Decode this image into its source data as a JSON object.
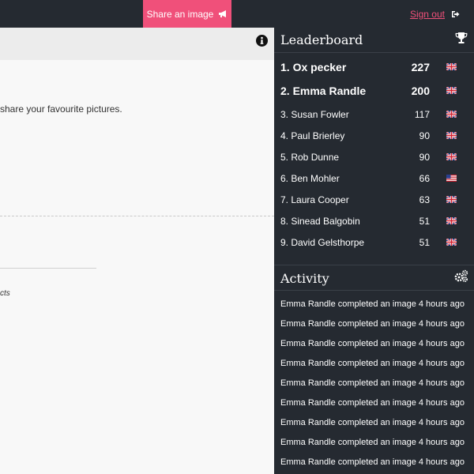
{
  "topbar": {
    "share_label": "Share an image",
    "signout_label": "Sign out"
  },
  "main": {
    "intro_text": "share your favourite pictures.",
    "italic_text": "cts"
  },
  "leaderboard": {
    "title": "Leaderboard",
    "entries": [
      {
        "label": "1. Ox pecker",
        "score": "227",
        "flag": "uk"
      },
      {
        "label": "2. Emma Randle",
        "score": "200",
        "flag": "uk"
      },
      {
        "label": "3. Susan Fowler",
        "score": "117",
        "flag": "uk"
      },
      {
        "label": "4. Paul Brierley",
        "score": "90",
        "flag": "uk"
      },
      {
        "label": "5. Rob Dunne",
        "score": "90",
        "flag": "uk"
      },
      {
        "label": "6. Ben Mohler",
        "score": "66",
        "flag": "us"
      },
      {
        "label": "7. Laura Cooper",
        "score": "63",
        "flag": "uk"
      },
      {
        "label": "8. Sinead Balgobin",
        "score": "51",
        "flag": "uk"
      },
      {
        "label": "9. David Gelsthorpe",
        "score": "51",
        "flag": "uk"
      }
    ]
  },
  "activity": {
    "title": "Activity",
    "items": [
      "Emma Randle completed an image 4 hours ago",
      "Emma Randle completed an image 4 hours ago",
      "Emma Randle completed an image 4 hours ago",
      "Emma Randle completed an image 4 hours ago",
      "Emma Randle completed an image 4 hours ago",
      "Emma Randle completed an image 4 hours ago",
      "Emma Randle completed an image 4 hours ago",
      "Emma Randle completed an image 4 hours ago",
      "Emma Randle completed an image 4 hours ago"
    ]
  },
  "colors": {
    "topbar_bg": "#252a31",
    "accent": "#f0507a",
    "sidebar_bg": "#252a31"
  },
  "icons": {
    "share": "megaphone-icon",
    "signout": "sign-out-icon",
    "info": "info-icon",
    "leaderboard": "trophy-icon",
    "activity": "gears-icon"
  }
}
